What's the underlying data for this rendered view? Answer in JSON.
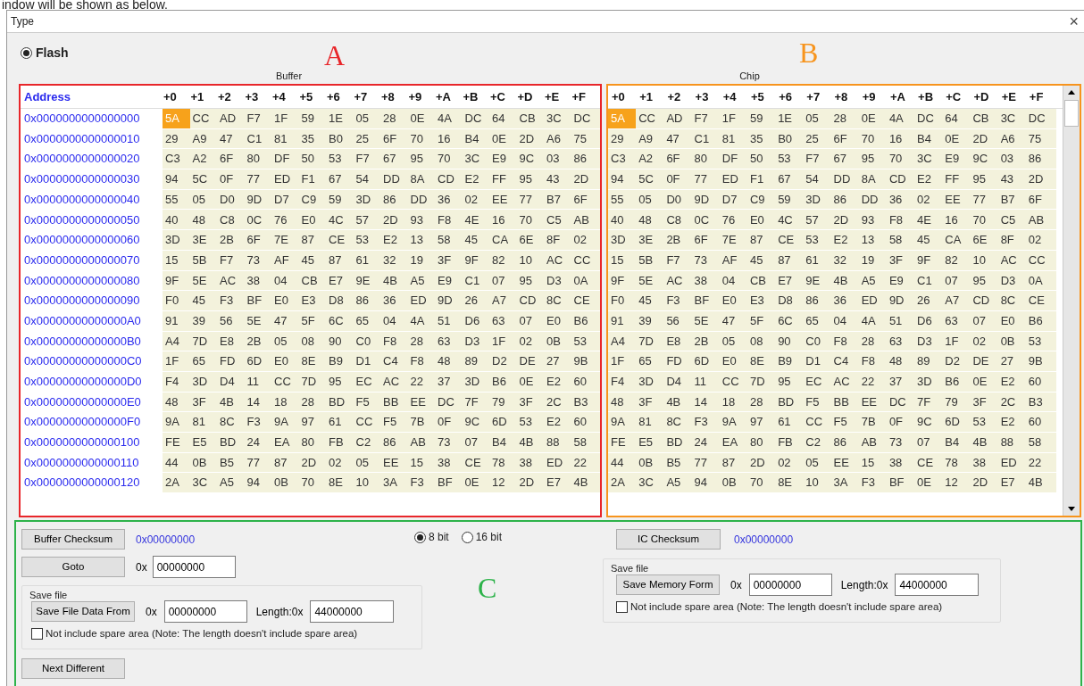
{
  "document_caption": "indow will be shown as below.",
  "window": {
    "title": "Type",
    "close": "×"
  },
  "memory_type": {
    "label": "Flash",
    "selected": true
  },
  "annotations": [
    {
      "letter": "A",
      "color": "#e8262a"
    },
    {
      "letter": "B",
      "color": "#f7941d"
    },
    {
      "letter": "C",
      "color": "#2db34a"
    }
  ],
  "buffer": {
    "title": "Buffer",
    "columns": [
      "Address",
      "+0",
      "+1",
      "+2",
      "+3",
      "+4",
      "+5",
      "+6",
      "+7",
      "+8",
      "+9",
      "+A",
      "+B",
      "+C",
      "+D",
      "+E",
      "+F"
    ],
    "rows": [
      {
        "address": "0x0000000000000000",
        "bytes": [
          "5A",
          "CC",
          "AD",
          "F7",
          "1F",
          "59",
          "1E",
          "05",
          "28",
          "0E",
          "4A",
          "DC",
          "64",
          "CB",
          "3C",
          "DC"
        ],
        "selected": [
          true,
          false,
          false,
          false,
          false,
          false,
          false,
          false,
          false,
          false,
          false,
          false,
          false,
          false,
          false,
          false
        ]
      },
      {
        "address": "0x0000000000000010",
        "bytes": [
          "29",
          "A9",
          "47",
          "C1",
          "81",
          "35",
          "B0",
          "25",
          "6F",
          "70",
          "16",
          "B4",
          "0E",
          "2D",
          "A6",
          "75"
        ],
        "selected": [
          false,
          false,
          false,
          false,
          false,
          false,
          false,
          false,
          false,
          false,
          false,
          false,
          false,
          false,
          false,
          false
        ]
      },
      {
        "address": "0x0000000000000020",
        "bytes": [
          "C3",
          "A2",
          "6F",
          "80",
          "DF",
          "50",
          "53",
          "F7",
          "67",
          "95",
          "70",
          "3C",
          "E9",
          "9C",
          "03",
          "86"
        ],
        "selected": [
          false,
          false,
          false,
          false,
          false,
          false,
          false,
          false,
          false,
          false,
          false,
          false,
          false,
          false,
          false,
          false
        ]
      },
      {
        "address": "0x0000000000000030",
        "bytes": [
          "94",
          "5C",
          "0F",
          "77",
          "ED",
          "F1",
          "67",
          "54",
          "DD",
          "8A",
          "CD",
          "E2",
          "FF",
          "95",
          "43",
          "2D"
        ],
        "selected": [
          false,
          false,
          false,
          false,
          false,
          false,
          false,
          false,
          false,
          false,
          false,
          false,
          false,
          false,
          false,
          false
        ]
      },
      {
        "address": "0x0000000000000040",
        "bytes": [
          "55",
          "05",
          "D0",
          "9D",
          "D7",
          "C9",
          "59",
          "3D",
          "86",
          "DD",
          "36",
          "02",
          "EE",
          "77",
          "B7",
          "6F"
        ],
        "selected": [
          false,
          false,
          false,
          false,
          false,
          false,
          false,
          false,
          false,
          false,
          false,
          false,
          false,
          false,
          false,
          false
        ]
      },
      {
        "address": "0x0000000000000050",
        "bytes": [
          "40",
          "48",
          "C8",
          "0C",
          "76",
          "E0",
          "4C",
          "57",
          "2D",
          "93",
          "F8",
          "4E",
          "16",
          "70",
          "C5",
          "AB"
        ],
        "selected": [
          false,
          false,
          false,
          false,
          false,
          false,
          false,
          false,
          false,
          false,
          false,
          false,
          false,
          false,
          false,
          false
        ]
      },
      {
        "address": "0x0000000000000060",
        "bytes": [
          "3D",
          "3E",
          "2B",
          "6F",
          "7E",
          "87",
          "CE",
          "53",
          "E2",
          "13",
          "58",
          "45",
          "CA",
          "6E",
          "8F",
          "02"
        ],
        "selected": [
          false,
          false,
          false,
          false,
          false,
          false,
          false,
          false,
          false,
          false,
          false,
          false,
          false,
          false,
          false,
          false
        ]
      },
      {
        "address": "0x0000000000000070",
        "bytes": [
          "15",
          "5B",
          "F7",
          "73",
          "AF",
          "45",
          "87",
          "61",
          "32",
          "19",
          "3F",
          "9F",
          "82",
          "10",
          "AC",
          "CC"
        ],
        "selected": [
          false,
          false,
          false,
          false,
          false,
          false,
          false,
          false,
          false,
          false,
          false,
          false,
          false,
          false,
          false,
          false
        ]
      },
      {
        "address": "0x0000000000000080",
        "bytes": [
          "9F",
          "5E",
          "AC",
          "38",
          "04",
          "CB",
          "E7",
          "9E",
          "4B",
          "A5",
          "E9",
          "C1",
          "07",
          "95",
          "D3",
          "0A"
        ],
        "selected": [
          false,
          false,
          false,
          false,
          false,
          false,
          false,
          false,
          false,
          false,
          false,
          false,
          false,
          false,
          false,
          false
        ]
      },
      {
        "address": "0x0000000000000090",
        "bytes": [
          "F0",
          "45",
          "F3",
          "BF",
          "E0",
          "E3",
          "D8",
          "86",
          "36",
          "ED",
          "9D",
          "26",
          "A7",
          "CD",
          "8C",
          "CE"
        ],
        "selected": [
          false,
          false,
          false,
          false,
          false,
          false,
          false,
          false,
          false,
          false,
          false,
          false,
          false,
          false,
          false,
          false
        ]
      },
      {
        "address": "0x00000000000000A0",
        "bytes": [
          "91",
          "39",
          "56",
          "5E",
          "47",
          "5F",
          "6C",
          "65",
          "04",
          "4A",
          "51",
          "D6",
          "63",
          "07",
          "E0",
          "B6"
        ],
        "selected": [
          false,
          false,
          false,
          false,
          false,
          false,
          false,
          false,
          false,
          false,
          false,
          false,
          false,
          false,
          false,
          false
        ]
      },
      {
        "address": "0x00000000000000B0",
        "bytes": [
          "A4",
          "7D",
          "E8",
          "2B",
          "05",
          "08",
          "90",
          "C0",
          "F8",
          "28",
          "63",
          "D3",
          "1F",
          "02",
          "0B",
          "53"
        ],
        "selected": [
          false,
          false,
          false,
          false,
          false,
          false,
          false,
          false,
          false,
          false,
          false,
          false,
          false,
          false,
          false,
          false
        ]
      },
      {
        "address": "0x00000000000000C0",
        "bytes": [
          "1F",
          "65",
          "FD",
          "6D",
          "E0",
          "8E",
          "B9",
          "D1",
          "C4",
          "F8",
          "48",
          "89",
          "D2",
          "DE",
          "27",
          "9B"
        ],
        "selected": [
          false,
          false,
          false,
          false,
          false,
          false,
          false,
          false,
          false,
          false,
          false,
          false,
          false,
          false,
          false,
          false
        ]
      },
      {
        "address": "0x00000000000000D0",
        "bytes": [
          "F4",
          "3D",
          "D4",
          "11",
          "CC",
          "7D",
          "95",
          "EC",
          "AC",
          "22",
          "37",
          "3D",
          "B6",
          "0E",
          "E2",
          "60"
        ],
        "selected": [
          false,
          false,
          false,
          false,
          false,
          false,
          false,
          false,
          false,
          false,
          false,
          false,
          false,
          false,
          false,
          false
        ]
      },
      {
        "address": "0x00000000000000E0",
        "bytes": [
          "48",
          "3F",
          "4B",
          "14",
          "18",
          "28",
          "BD",
          "F5",
          "BB",
          "EE",
          "DC",
          "7F",
          "79",
          "3F",
          "2C",
          "B3"
        ],
        "selected": [
          false,
          false,
          false,
          false,
          false,
          false,
          false,
          false,
          false,
          false,
          false,
          false,
          false,
          false,
          false,
          false
        ]
      },
      {
        "address": "0x00000000000000F0",
        "bytes": [
          "9A",
          "81",
          "8C",
          "F3",
          "9A",
          "97",
          "61",
          "CC",
          "F5",
          "7B",
          "0F",
          "9C",
          "6D",
          "53",
          "E2",
          "60"
        ],
        "selected": [
          false,
          false,
          false,
          false,
          false,
          false,
          false,
          false,
          false,
          false,
          false,
          false,
          false,
          false,
          false,
          false
        ]
      },
      {
        "address": "0x0000000000000100",
        "bytes": [
          "FE",
          "E5",
          "BD",
          "24",
          "EA",
          "80",
          "FB",
          "C2",
          "86",
          "AB",
          "73",
          "07",
          "B4",
          "4B",
          "88",
          "58"
        ],
        "selected": [
          false,
          false,
          false,
          false,
          false,
          false,
          false,
          false,
          false,
          false,
          false,
          false,
          false,
          false,
          false,
          false
        ]
      },
      {
        "address": "0x0000000000000110",
        "bytes": [
          "44",
          "0B",
          "B5",
          "77",
          "87",
          "2D",
          "02",
          "05",
          "EE",
          "15",
          "38",
          "CE",
          "78",
          "38",
          "ED",
          "22"
        ],
        "selected": [
          false,
          false,
          false,
          false,
          false,
          false,
          false,
          false,
          false,
          false,
          false,
          false,
          false,
          false,
          false,
          false
        ]
      },
      {
        "address": "0x0000000000000120",
        "bytes": [
          "2A",
          "3C",
          "A5",
          "94",
          "0B",
          "70",
          "8E",
          "10",
          "3A",
          "F3",
          "BF",
          "0E",
          "12",
          "2D",
          "E7",
          "4B"
        ],
        "selected": [
          false,
          false,
          false,
          false,
          false,
          false,
          false,
          false,
          false,
          false,
          false,
          false,
          false,
          false,
          false,
          false
        ]
      }
    ]
  },
  "chip": {
    "title": "Chip",
    "columns": [
      "+0",
      "+1",
      "+2",
      "+3",
      "+4",
      "+5",
      "+6",
      "+7",
      "+8",
      "+9",
      "+A",
      "+B",
      "+C",
      "+D",
      "+E",
      "+F"
    ],
    "rows": [
      {
        "bytes": [
          "5A",
          "CC",
          "AD",
          "F7",
          "1F",
          "59",
          "1E",
          "05",
          "28",
          "0E",
          "4A",
          "DC",
          "64",
          "CB",
          "3C",
          "DC"
        ],
        "selected": [
          true,
          false,
          false,
          false,
          false,
          false,
          false,
          false,
          false,
          false,
          false,
          false,
          false,
          false,
          false,
          false
        ]
      },
      {
        "bytes": [
          "29",
          "A9",
          "47",
          "C1",
          "81",
          "35",
          "B0",
          "25",
          "6F",
          "70",
          "16",
          "B4",
          "0E",
          "2D",
          "A6",
          "75"
        ],
        "selected": [
          false,
          false,
          false,
          false,
          false,
          false,
          false,
          false,
          false,
          false,
          false,
          false,
          false,
          false,
          false,
          false
        ]
      },
      {
        "bytes": [
          "C3",
          "A2",
          "6F",
          "80",
          "DF",
          "50",
          "53",
          "F7",
          "67",
          "95",
          "70",
          "3C",
          "E9",
          "9C",
          "03",
          "86"
        ],
        "selected": [
          false,
          false,
          false,
          false,
          false,
          false,
          false,
          false,
          false,
          false,
          false,
          false,
          false,
          false,
          false,
          false
        ]
      },
      {
        "bytes": [
          "94",
          "5C",
          "0F",
          "77",
          "ED",
          "F1",
          "67",
          "54",
          "DD",
          "8A",
          "CD",
          "E2",
          "FF",
          "95",
          "43",
          "2D"
        ],
        "selected": [
          false,
          false,
          false,
          false,
          false,
          false,
          false,
          false,
          false,
          false,
          false,
          false,
          false,
          false,
          false,
          false
        ]
      },
      {
        "bytes": [
          "55",
          "05",
          "D0",
          "9D",
          "D7",
          "C9",
          "59",
          "3D",
          "86",
          "DD",
          "36",
          "02",
          "EE",
          "77",
          "B7",
          "6F"
        ],
        "selected": [
          false,
          false,
          false,
          false,
          false,
          false,
          false,
          false,
          false,
          false,
          false,
          false,
          false,
          false,
          false,
          false
        ]
      },
      {
        "bytes": [
          "40",
          "48",
          "C8",
          "0C",
          "76",
          "E0",
          "4C",
          "57",
          "2D",
          "93",
          "F8",
          "4E",
          "16",
          "70",
          "C5",
          "AB"
        ],
        "selected": [
          false,
          false,
          false,
          false,
          false,
          false,
          false,
          false,
          false,
          false,
          false,
          false,
          false,
          false,
          false,
          false
        ]
      },
      {
        "bytes": [
          "3D",
          "3E",
          "2B",
          "6F",
          "7E",
          "87",
          "CE",
          "53",
          "E2",
          "13",
          "58",
          "45",
          "CA",
          "6E",
          "8F",
          "02"
        ],
        "selected": [
          false,
          false,
          false,
          false,
          false,
          false,
          false,
          false,
          false,
          false,
          false,
          false,
          false,
          false,
          false,
          false
        ]
      },
      {
        "bytes": [
          "15",
          "5B",
          "F7",
          "73",
          "AF",
          "45",
          "87",
          "61",
          "32",
          "19",
          "3F",
          "9F",
          "82",
          "10",
          "AC",
          "CC"
        ],
        "selected": [
          false,
          false,
          false,
          false,
          false,
          false,
          false,
          false,
          false,
          false,
          false,
          false,
          false,
          false,
          false,
          false
        ]
      },
      {
        "bytes": [
          "9F",
          "5E",
          "AC",
          "38",
          "04",
          "CB",
          "E7",
          "9E",
          "4B",
          "A5",
          "E9",
          "C1",
          "07",
          "95",
          "D3",
          "0A"
        ],
        "selected": [
          false,
          false,
          false,
          false,
          false,
          false,
          false,
          false,
          false,
          false,
          false,
          false,
          false,
          false,
          false,
          false
        ]
      },
      {
        "bytes": [
          "F0",
          "45",
          "F3",
          "BF",
          "E0",
          "E3",
          "D8",
          "86",
          "36",
          "ED",
          "9D",
          "26",
          "A7",
          "CD",
          "8C",
          "CE"
        ],
        "selected": [
          false,
          false,
          false,
          false,
          false,
          false,
          false,
          false,
          false,
          false,
          false,
          false,
          false,
          false,
          false,
          false
        ]
      },
      {
        "bytes": [
          "91",
          "39",
          "56",
          "5E",
          "47",
          "5F",
          "6C",
          "65",
          "04",
          "4A",
          "51",
          "D6",
          "63",
          "07",
          "E0",
          "B6"
        ],
        "selected": [
          false,
          false,
          false,
          false,
          false,
          false,
          false,
          false,
          false,
          false,
          false,
          false,
          false,
          false,
          false,
          false
        ]
      },
      {
        "bytes": [
          "A4",
          "7D",
          "E8",
          "2B",
          "05",
          "08",
          "90",
          "C0",
          "F8",
          "28",
          "63",
          "D3",
          "1F",
          "02",
          "0B",
          "53"
        ],
        "selected": [
          false,
          false,
          false,
          false,
          false,
          false,
          false,
          false,
          false,
          false,
          false,
          false,
          false,
          false,
          false,
          false
        ]
      },
      {
        "bytes": [
          "1F",
          "65",
          "FD",
          "6D",
          "E0",
          "8E",
          "B9",
          "D1",
          "C4",
          "F8",
          "48",
          "89",
          "D2",
          "DE",
          "27",
          "9B"
        ],
        "selected": [
          false,
          false,
          false,
          false,
          false,
          false,
          false,
          false,
          false,
          false,
          false,
          false,
          false,
          false,
          false,
          false
        ]
      },
      {
        "bytes": [
          "F4",
          "3D",
          "D4",
          "11",
          "CC",
          "7D",
          "95",
          "EC",
          "AC",
          "22",
          "37",
          "3D",
          "B6",
          "0E",
          "E2",
          "60"
        ],
        "selected": [
          false,
          false,
          false,
          false,
          false,
          false,
          false,
          false,
          false,
          false,
          false,
          false,
          false,
          false,
          false,
          false
        ]
      },
      {
        "bytes": [
          "48",
          "3F",
          "4B",
          "14",
          "18",
          "28",
          "BD",
          "F5",
          "BB",
          "EE",
          "DC",
          "7F",
          "79",
          "3F",
          "2C",
          "B3"
        ],
        "selected": [
          false,
          false,
          false,
          false,
          false,
          false,
          false,
          false,
          false,
          false,
          false,
          false,
          false,
          false,
          false,
          false
        ]
      },
      {
        "bytes": [
          "9A",
          "81",
          "8C",
          "F3",
          "9A",
          "97",
          "61",
          "CC",
          "F5",
          "7B",
          "0F",
          "9C",
          "6D",
          "53",
          "E2",
          "60"
        ],
        "selected": [
          false,
          false,
          false,
          false,
          false,
          false,
          false,
          false,
          false,
          false,
          false,
          false,
          false,
          false,
          false,
          false
        ]
      },
      {
        "bytes": [
          "FE",
          "E5",
          "BD",
          "24",
          "EA",
          "80",
          "FB",
          "C2",
          "86",
          "AB",
          "73",
          "07",
          "B4",
          "4B",
          "88",
          "58"
        ],
        "selected": [
          false,
          false,
          false,
          false,
          false,
          false,
          false,
          false,
          false,
          false,
          false,
          false,
          false,
          false,
          false,
          false
        ]
      },
      {
        "bytes": [
          "44",
          "0B",
          "B5",
          "77",
          "87",
          "2D",
          "02",
          "05",
          "EE",
          "15",
          "38",
          "CE",
          "78",
          "38",
          "ED",
          "22"
        ],
        "selected": [
          false,
          false,
          false,
          false,
          false,
          false,
          false,
          false,
          false,
          false,
          false,
          false,
          false,
          false,
          false,
          false
        ]
      },
      {
        "bytes": [
          "2A",
          "3C",
          "A5",
          "94",
          "0B",
          "70",
          "8E",
          "10",
          "3A",
          "F3",
          "BF",
          "0E",
          "12",
          "2D",
          "E7",
          "4B"
        ],
        "selected": [
          false,
          false,
          false,
          false,
          false,
          false,
          false,
          false,
          false,
          false,
          false,
          false,
          false,
          false,
          false,
          false
        ]
      }
    ]
  },
  "controls": {
    "buffer_checksum": {
      "button": "Buffer Checksum",
      "value": "0x00000000"
    },
    "goto": {
      "button": "Goto",
      "prefix": "0x",
      "value": "00000000"
    },
    "bit_width": [
      {
        "label": "8 bit",
        "selected": true
      },
      {
        "label": "16 bit",
        "selected": false
      }
    ],
    "save_buffer": {
      "group": "Save file",
      "button": "Save File Data From",
      "prefix": "0x",
      "start": "00000000",
      "length_label": "Length:0x",
      "length": "44000000",
      "exclude_spare": {
        "label": "Not include spare area (Note: The length doesn't include spare area)",
        "checked": false
      }
    },
    "next_different": "Next Different",
    "ic_checksum": {
      "button": "IC Checksum",
      "value": "0x00000000"
    },
    "save_chip": {
      "group": "Save file",
      "button": "Save Memory Form",
      "prefix": "0x",
      "start": "00000000",
      "length_label": "Length:0x",
      "length": "44000000",
      "exclude_spare": {
        "label": "Not include spare area (Note: The length doesn't include spare area)",
        "checked": false
      }
    }
  }
}
